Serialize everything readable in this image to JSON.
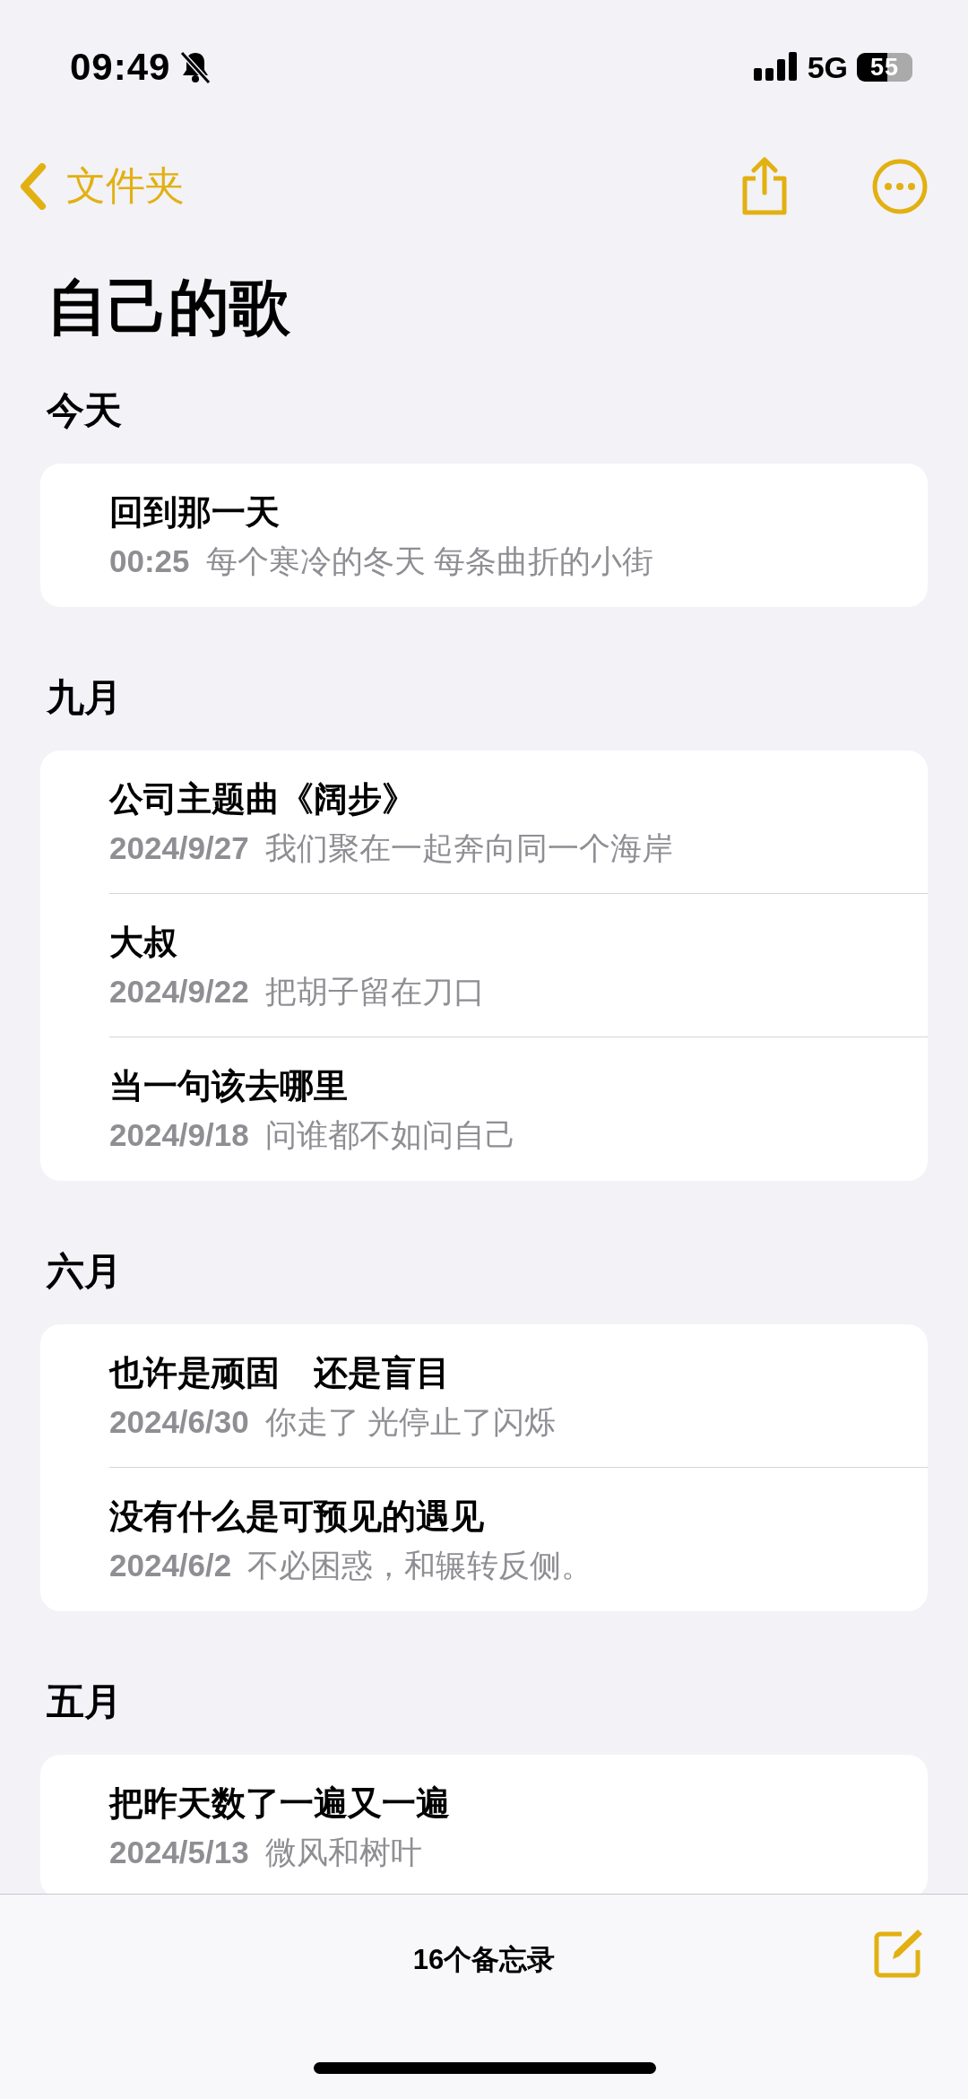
{
  "status_bar": {
    "time": "09:49",
    "network": "5G",
    "battery": "55"
  },
  "nav": {
    "back_label": "文件夹"
  },
  "title": "自己的歌",
  "sections": [
    {
      "header": "今天",
      "notes": [
        {
          "title": "回到那一天",
          "date": "00:25",
          "preview": "每个寒冷的冬天 每条曲折的小街"
        }
      ]
    },
    {
      "header": "九月",
      "notes": [
        {
          "title": "公司主题曲《阔步》",
          "date": "2024/9/27",
          "preview": "我们聚在一起奔向同一个海岸"
        },
        {
          "title": "大叔",
          "date": "2024/9/22",
          "preview": "把胡子留在刀口"
        },
        {
          "title": "当一句该去哪里",
          "date": "2024/9/18",
          "preview": "问谁都不如问自己"
        }
      ]
    },
    {
      "header": "六月",
      "notes": [
        {
          "title": "也许是顽固　还是盲目",
          "date": "2024/6/30",
          "preview": "你走了 光停止了闪烁"
        },
        {
          "title": "没有什么是可预见的遇见",
          "date": "2024/6/2",
          "preview": "不必困惑，和辗转反侧。"
        }
      ]
    },
    {
      "header": "五月",
      "notes": [
        {
          "title": "把昨天数了一遍又一遍",
          "date": "2024/5/13",
          "preview": "微风和树叶"
        }
      ]
    }
  ],
  "toolbar": {
    "count": "16个备忘录"
  }
}
